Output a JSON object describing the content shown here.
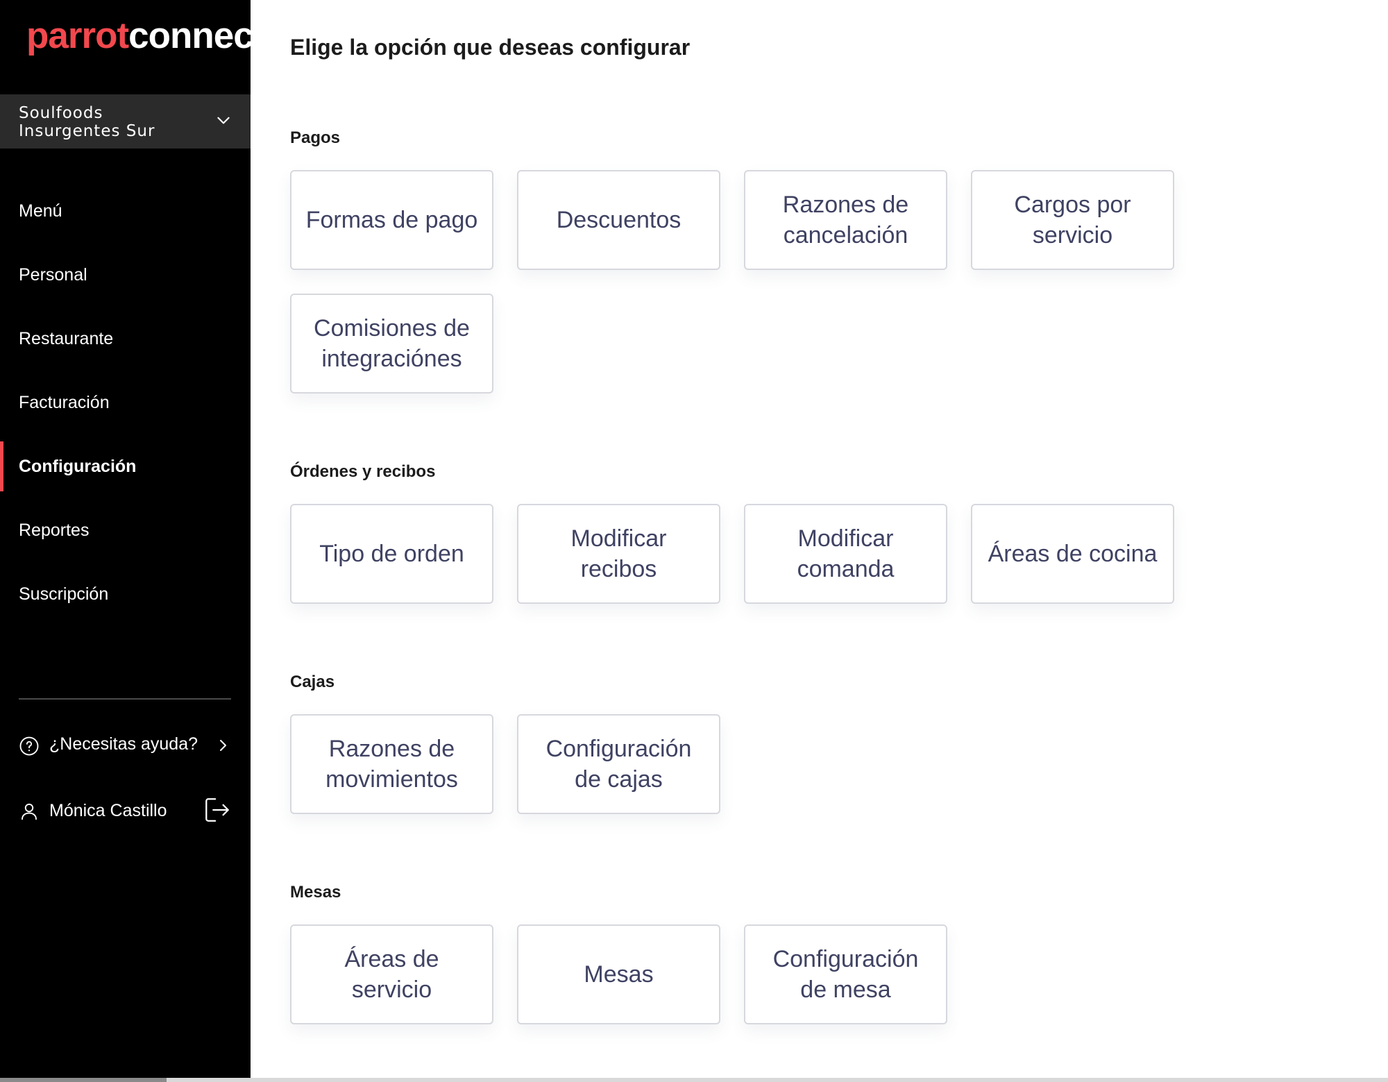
{
  "brand": {
    "part1": "parrot",
    "part2": "connect",
    "accent": "#f2484e"
  },
  "branch": {
    "line1": "Soulfoods",
    "line2": "Insurgentes Sur"
  },
  "nav": {
    "items": [
      {
        "label": "Menú"
      },
      {
        "label": "Personal"
      },
      {
        "label": "Restaurante"
      },
      {
        "label": "Facturación"
      },
      {
        "label": "Configuración"
      },
      {
        "label": "Reportes"
      },
      {
        "label": "Suscripción"
      }
    ]
  },
  "help": {
    "label": "¿Necesitas ayuda?",
    "icon": "question-circle-icon"
  },
  "user": {
    "name": "Mónica Castillo",
    "icon": "user-icon",
    "logout_icon": "logout-icon"
  },
  "main": {
    "title": "Elige la opción que deseas configurar",
    "sections": [
      {
        "title": "Pagos",
        "cards": [
          "Formas de pago",
          "Descuentos",
          "Razones de cancelación",
          "Cargos por servicio",
          "Comisiones de integraciónes"
        ]
      },
      {
        "title": "Órdenes y recibos",
        "cards": [
          "Tipo de orden",
          "Modificar recibos",
          "Modificar comanda",
          "Áreas de cocina"
        ]
      },
      {
        "title": "Cajas",
        "cards": [
          "Razones de movimientos",
          "Configuración de cajas"
        ]
      },
      {
        "title": "Mesas",
        "cards": [
          "Áreas de servicio",
          "Mesas",
          "Configuración de mesa"
        ]
      }
    ]
  }
}
